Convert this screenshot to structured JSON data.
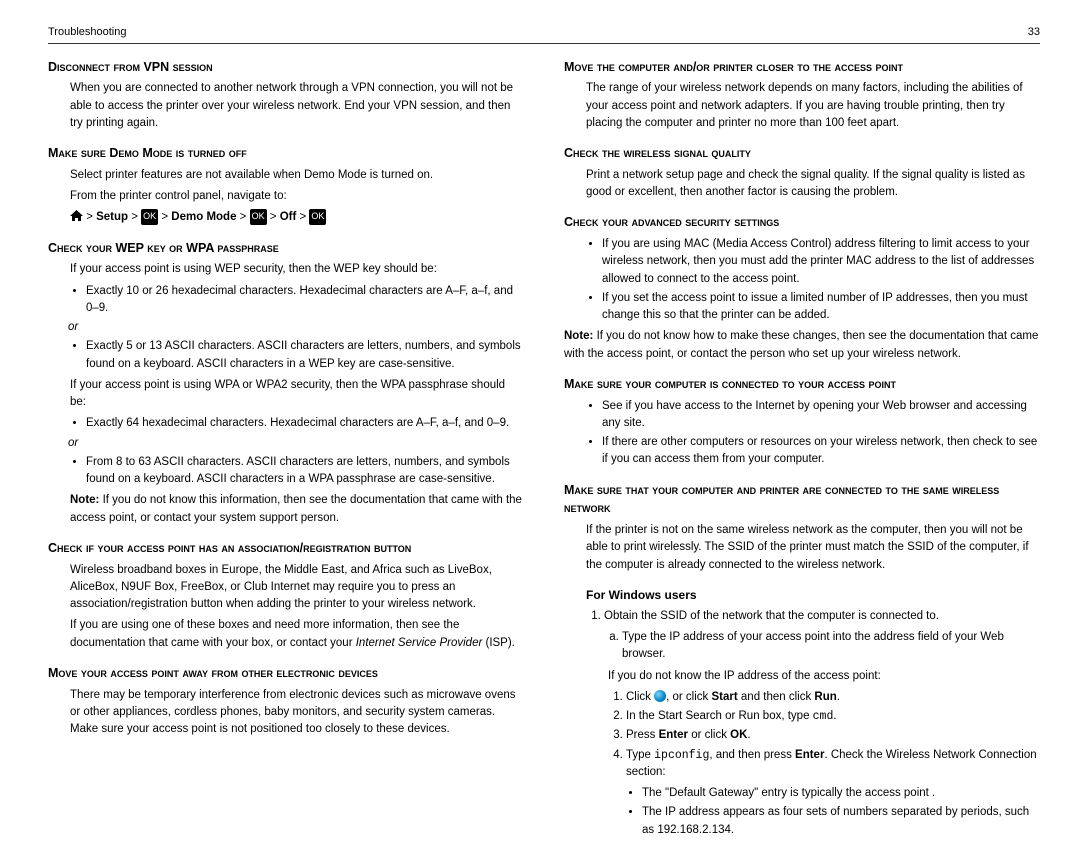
{
  "header": {
    "section": "Troubleshooting",
    "page": "33"
  },
  "left": {
    "h_vpn": "Disconnect from VPN session",
    "p_vpn": "When you are connected to another network through a VPN connection, you will not be able to access the printer over your wireless network. End your VPN session, and then try printing again.",
    "h_demo": "Make sure Demo Mode is turned off",
    "p_demo1": "Select printer features are not available when Demo Mode is turned on.",
    "p_demo2": "From the printer control panel, navigate to:",
    "nav": {
      "setup": "Setup",
      "demoMode": "Demo Mode",
      "off": "Off",
      "ok": "OK"
    },
    "h_wep": "Check your WEP key or WPA passphrase",
    "p_wep1": "If your access point is using WEP security, then the WEP key should be:",
    "li_wep_a": "Exactly 10 or 26 hexadecimal characters. Hexadecimal characters are A–F, a–f, and 0–9.",
    "li_wep_b": "Exactly 5 or 13 ASCII characters. ASCII characters are letters, numbers, and symbols found on a keyboard. ASCII characters in a WEP key are case-sensitive.",
    "p_wep2": "If your access point is using WPA or WPA2 security, then the WPA passphrase should be:",
    "li_wpa_a": "Exactly 64 hexadecimal characters. Hexadecimal characters are A–F, a–f, and 0–9.",
    "li_wpa_b": "From 8 to 63 ASCII characters. ASCII characters are letters, numbers, and symbols found on a keyboard. ASCII characters in a WPA passphrase are case-sensitive.",
    "or": "or",
    "note_wep_label": "Note:",
    "note_wep": " If you do not know this information, then see the documentation that came with the access point, or contact your system support person.",
    "h_assoc": "Check if your access point has an association/registration button",
    "p_assoc1": "Wireless broadband boxes in Europe, the Middle East, and Africa such as LiveBox, AliceBox, N9UF Box, FreeBox, or Club Internet may require you to press an association/registration button when adding the printer to your wireless network.",
    "p_assoc2a": "If you are using one of these boxes and need more information, then see the documentation that came with your box, or contact your ",
    "p_assoc2b": "Internet Service Provider",
    "p_assoc2c": " (ISP).",
    "h_move": "Move your access point away from other electronic devices",
    "p_move": "There may be temporary interference from electronic devices such as microwave ovens or other appliances, cordless phones, baby monitors, and security system cameras. Make sure your access point is not positioned too closely to these devices."
  },
  "right": {
    "h_closer": "Move the computer and/or printer closer to the access point",
    "p_closer": "The range of your wireless network depends on many factors, including the abilities of your access point and network adapters. If you are having trouble printing, then try placing the computer and printer no more than 100 feet apart.",
    "h_signal": "Check the wireless signal quality",
    "p_signal": "Print a network setup page and check the signal quality. If the signal quality is listed as good or excellent, then another factor is causing the problem.",
    "h_adv": "Check your advanced security settings",
    "li_adv_a": "If you are using MAC (Media Access Control) address filtering to limit access to your wireless network, then you must add the printer MAC address to the list of addresses allowed to connect to the access point.",
    "li_adv_b": "If you set the access point to issue a limited number of IP addresses, then you must change this so that the printer can be added.",
    "note_adv_label": "Note:",
    "note_adv": " If you do not know how to make these changes, then see the documentation that came with the access point, or contact the person who set up your wireless network.",
    "h_conn": "Make sure your computer is connected to your access point",
    "li_conn_a": "See if you have access to the Internet by opening your Web browser and accessing any site.",
    "li_conn_b": "If there are other computers or resources on your wireless network, then check to see if you can access them from your computer.",
    "h_same": "Make sure that your computer and printer are connected to the same wireless network",
    "p_same": "If the printer is not on the same wireless network as the computer, then you will not be able to print wirelessly. The SSID of the printer must match the SSID of the computer, if the computer is already connected to the wireless network.",
    "h_win": "For Windows users",
    "ol1": "Obtain the SSID of the network that the computer is connected to.",
    "ol1a": "Type the IP address of your access point into the address field of your Web browser.",
    "p_ifip": "If you do not know the IP address of the access point:",
    "s1a": "Click ",
    "s1b": ", or click ",
    "s1c": "Start",
    "s1d": " and then click ",
    "s1e": "Run",
    "s1f": ".",
    "s2a": "In the Start Search or Run box, type ",
    "s2b": "cmd",
    "s2c": ".",
    "s3a": "Press ",
    "s3b": "Enter",
    "s3c": " or click ",
    "s3d": "OK",
    "s3e": ".",
    "s4a": "Type ",
    "s4b": "ipconfig",
    "s4c": ", and then press ",
    "s4d": "Enter",
    "s4e": ". Check the Wireless Network Connection section:",
    "b1": "The \"Default Gateway\" entry is typically the access point .",
    "b2": "The IP address appears as four sets of numbers separated by periods, such as 192.168.2.134."
  }
}
